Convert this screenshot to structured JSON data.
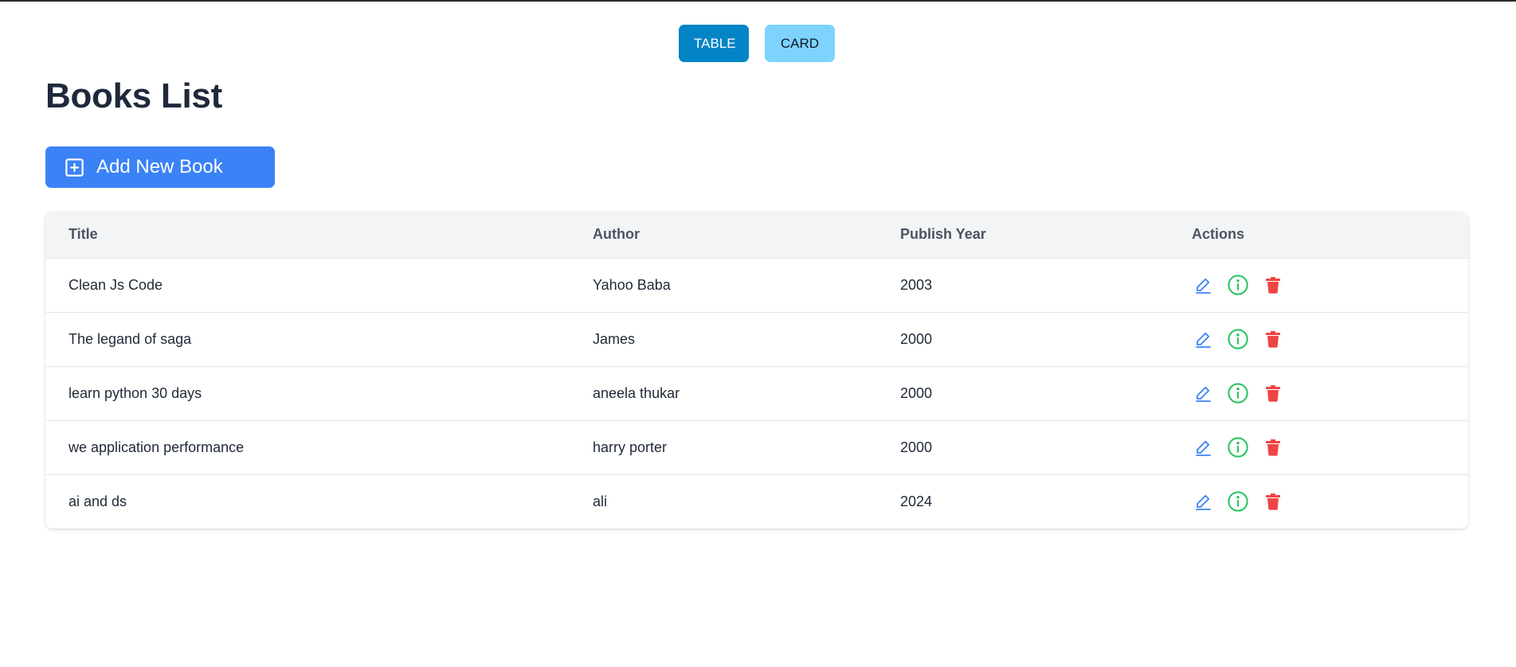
{
  "view_toggle": {
    "table_label": "TABLE",
    "card_label": "CARD"
  },
  "page": {
    "title": "Books List",
    "add_button_label": "Add New Book"
  },
  "table": {
    "headers": {
      "title": "Title",
      "author": "Author",
      "year": "Publish Year",
      "actions": "Actions"
    },
    "rows": [
      {
        "title": "Clean Js Code",
        "author": "Yahoo Baba",
        "year": "2003"
      },
      {
        "title": "The legand of saga",
        "author": "James",
        "year": "2000"
      },
      {
        "title": "learn python 30 days",
        "author": "aneela thukar",
        "year": "2000"
      },
      {
        "title": "we application performance",
        "author": "harry porter",
        "year": "2000"
      },
      {
        "title": "ai and ds",
        "author": "ali",
        "year": "2024"
      }
    ]
  },
  "colors": {
    "toggle_active": "#0284c7",
    "toggle_inactive": "#7dd3fc",
    "primary": "#3b82f6",
    "edit_icon": "#3b82f6",
    "info_icon": "#22c55e",
    "delete_icon": "#ef4444"
  },
  "icons": {
    "add": "plus-square-icon",
    "edit": "pencil-icon",
    "info": "info-circle-icon",
    "delete": "trash-icon"
  }
}
